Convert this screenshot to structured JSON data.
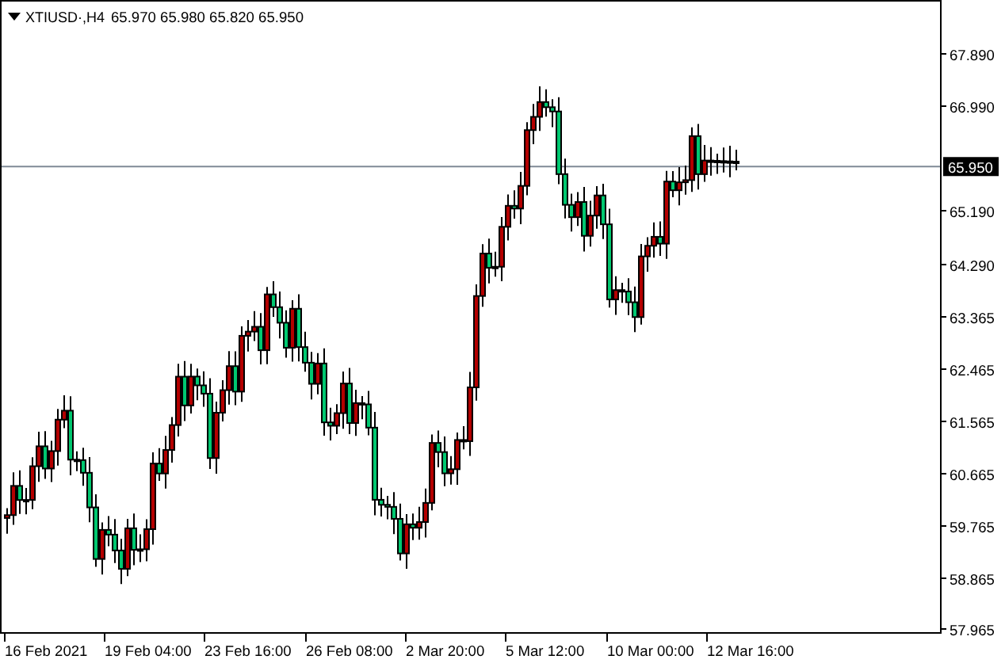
{
  "header": {
    "symbol": "XTIUSD·,H4",
    "ohlc": "65.970 65.980 65.820 65.950"
  },
  "price_axis": {
    "labels": [
      "67.890",
      "66.990",
      "65.190",
      "64.290",
      "63.365",
      "62.465",
      "61.565",
      "60.665",
      "59.765",
      "58.865",
      "57.965"
    ],
    "current_price": "65.950"
  },
  "time_axis": {
    "labels": [
      "16 Feb 2021",
      "19 Feb 04:00",
      "23 Feb 16:00",
      "26 Feb 08:00",
      "2 Mar 20:00",
      "5 Mar 12:00",
      "10 Mar 00:00",
      "12 Mar 16:00"
    ]
  }
}
